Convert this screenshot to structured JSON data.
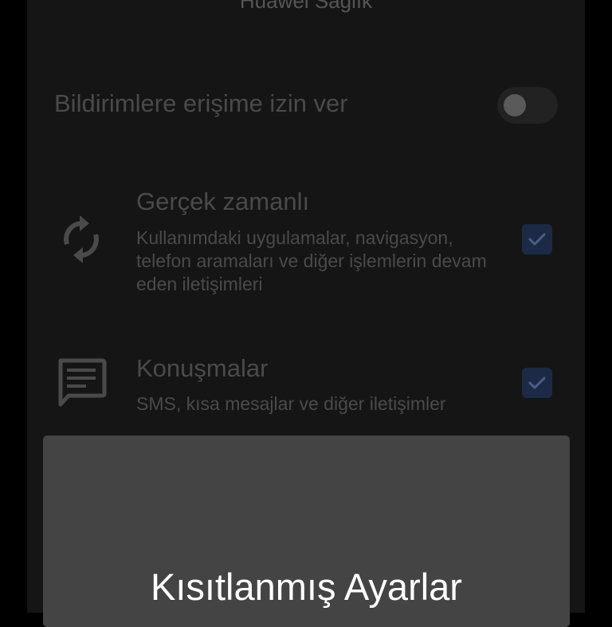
{
  "app": {
    "title": "Huawei Sağlık"
  },
  "notification_access": {
    "label": "Bildirimlere erişime izin ver",
    "enabled": false
  },
  "permissions": [
    {
      "icon": "sync-icon",
      "title": "Gerçek zamanlı",
      "description": "Kullanımdaki uygulamalar, navigasyon, telefon aramaları ve diğer işlemlerin devam eden iletişimleri",
      "checked": true
    },
    {
      "icon": "message-icon",
      "title": "Konuşmalar",
      "description": "SMS, kısa mesajlar ve diğer iletişimler",
      "checked": true
    }
  ],
  "dialog": {
    "title": "Kısıtlanmış Ayarlar"
  },
  "colors": {
    "background": "#151515",
    "dimmed_text": "#4a4a4a",
    "checkbox_fill": "#1c2a45",
    "checkbox_check": "#4a5f86",
    "dialog_background": "#444444",
    "dialog_text": "#ffffff"
  }
}
